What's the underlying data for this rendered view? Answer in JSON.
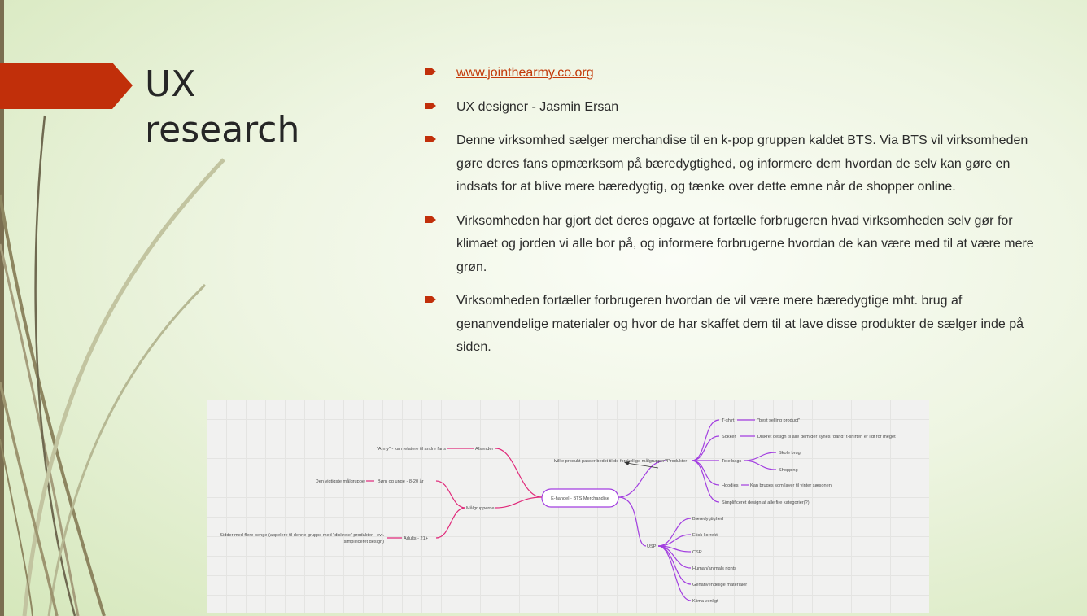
{
  "slide": {
    "title_lines": [
      "UX",
      "research"
    ],
    "bullets": [
      {
        "text": "www.jointhearmy.co.org",
        "is_link": true
      },
      {
        "text": "UX designer - Jasmin Ersan"
      },
      {
        "text": "Denne virksomhed sælger merchandise til en k-pop gruppen kaldet BTS. Via BTS vil virksomheden gøre deres fans opmærksom på bæredygtighed, og informere dem hvordan de selv kan gøre en indsats for at blive mere bæredygtig, og tænke over dette emne når de shopper online."
      },
      {
        "text": "Virksomheden har gjort det deres opgave at fortælle forbrugeren hvad virksomheden selv gør for klimaet og jorden vi alle bor på, og informere forbrugerne hvordan de kan være med til at være mere grøn."
      },
      {
        "text": "Virksomheden  fortæller forbrugeren hvordan de vil være mere bæredygtige mht. brug af genanvendelige materialer og hvor de har skaffet dem til at lave disse produkter de sælger inde på siden."
      }
    ],
    "colors": {
      "accent": "#c12f0a",
      "left_bar": "#7a6e50",
      "mindmap_pink": "#e0297a",
      "mindmap_purple": "#a23de0"
    }
  },
  "mindmap": {
    "central": "E-handel - BTS Merchandise",
    "left": {
      "afsender": "Afsender",
      "afsender_note": "\"Army\" - kan relatere til andre fans",
      "maalgrupperne": "Målgrupperne",
      "group1": "Børn og unge - 8-20 år",
      "group1_note": "Den vigtigste målgruppe",
      "group2": "Adults - 21+",
      "group2_note_1": "Sidder med flere penge (appelere til denne gruppe med \"diskrete\" produkter - evt.",
      "group2_note_2": "simplificeret design)"
    },
    "right": {
      "question": "Hvilke produkt passer bedst til de forskellige målgrupper?",
      "produkter": "Produkter",
      "tshirt": "T-shirt",
      "tshirt_note": "\"best selling product\"",
      "sokker": "Sokker",
      "sokker_note": "Diskret design til alle dem der synes \"band\" t-shirten er lidt for meget",
      "tote": "Tote bags",
      "tote_1": "Skole brug",
      "tote_2": "Shopping",
      "hoodies": "Hoodies",
      "hoodies_note": "Kan bruges som layer til vinter sæsonen",
      "simplified": "Simplificeret design af alle fire kategorier(?)",
      "usp": "USP",
      "usp_items": [
        "Bæredygtighed",
        "Etisk korrekt",
        "CSR",
        "Human/animals rights",
        "Genanvendelige materialer",
        "Klima venligt"
      ]
    }
  }
}
